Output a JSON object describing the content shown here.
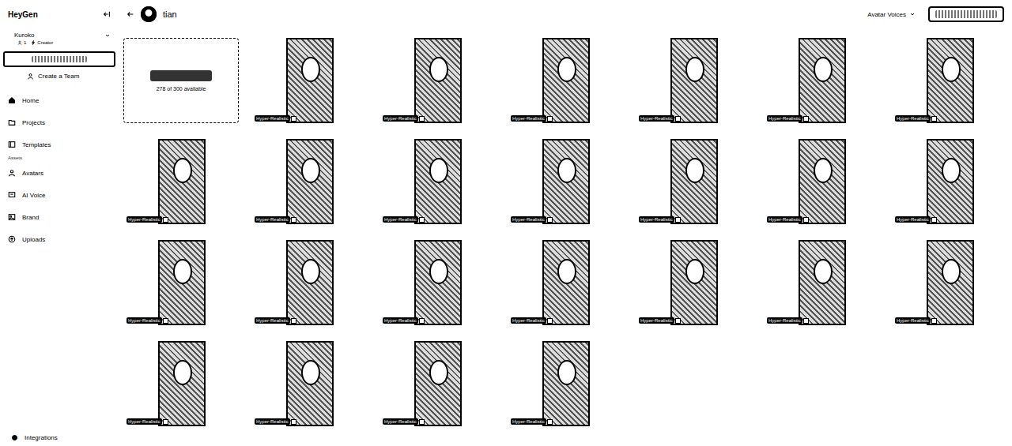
{
  "sidebar": {
    "logo": "HeyGen",
    "user": {
      "name": "Kuroko",
      "members": "1",
      "plan": "Creator"
    },
    "create_team": "Create a Team",
    "items": [
      {
        "label": "Home",
        "selected": false,
        "kind": "home"
      },
      {
        "label": "Projects",
        "selected": false,
        "kind": "folder"
      },
      {
        "label": "Templates",
        "selected": false,
        "kind": "template"
      }
    ],
    "section": "Assets",
    "asset_items": [
      {
        "label": "Avatars",
        "selected": false,
        "kind": "person"
      },
      {
        "label": "AI Voice",
        "selected": false,
        "kind": "voice"
      },
      {
        "label": "Brand",
        "selected": false,
        "kind": "brand"
      },
      {
        "label": "Uploads",
        "selected": false,
        "kind": "upload"
      }
    ],
    "footer": "Integrations"
  },
  "header": {
    "title": "tian",
    "dropdown": "Avatar Voices"
  },
  "add_card": {
    "availability": "278 of 300 available"
  },
  "tiles": [
    {
      "badge": "Hyper-Realistic"
    },
    {
      "badge": "Hyper-Realistic"
    },
    {
      "badge": "Hyper-Realistic"
    },
    {
      "badge": "Hyper-Realistic"
    },
    {
      "badge": "Hyper-Realistic"
    },
    {
      "badge": "Hyper-Realistic"
    },
    {
      "badge": "Hyper-Realistic"
    },
    {
      "badge": "Hyper-Realistic"
    },
    {
      "badge": "Hyper-Realistic"
    },
    {
      "badge": "Hyper-Realistic"
    },
    {
      "badge": "Hyper-Realistic"
    },
    {
      "badge": "Hyper-Realistic"
    },
    {
      "badge": "Hyper-Realistic"
    },
    {
      "badge": "Hyper-Realistic"
    },
    {
      "badge": "Hyper-Realistic"
    },
    {
      "badge": "Hyper-Realistic"
    },
    {
      "badge": "Hyper-Realistic"
    },
    {
      "badge": "Hyper-Realistic"
    },
    {
      "badge": "Hyper-Realistic"
    },
    {
      "badge": "Hyper-Realistic"
    },
    {
      "badge": "Hyper-Realistic"
    },
    {
      "badge": "Hyper-Realistic"
    },
    {
      "badge": "Hyper-Realistic"
    },
    {
      "badge": "Hyper-Realistic"
    }
  ]
}
